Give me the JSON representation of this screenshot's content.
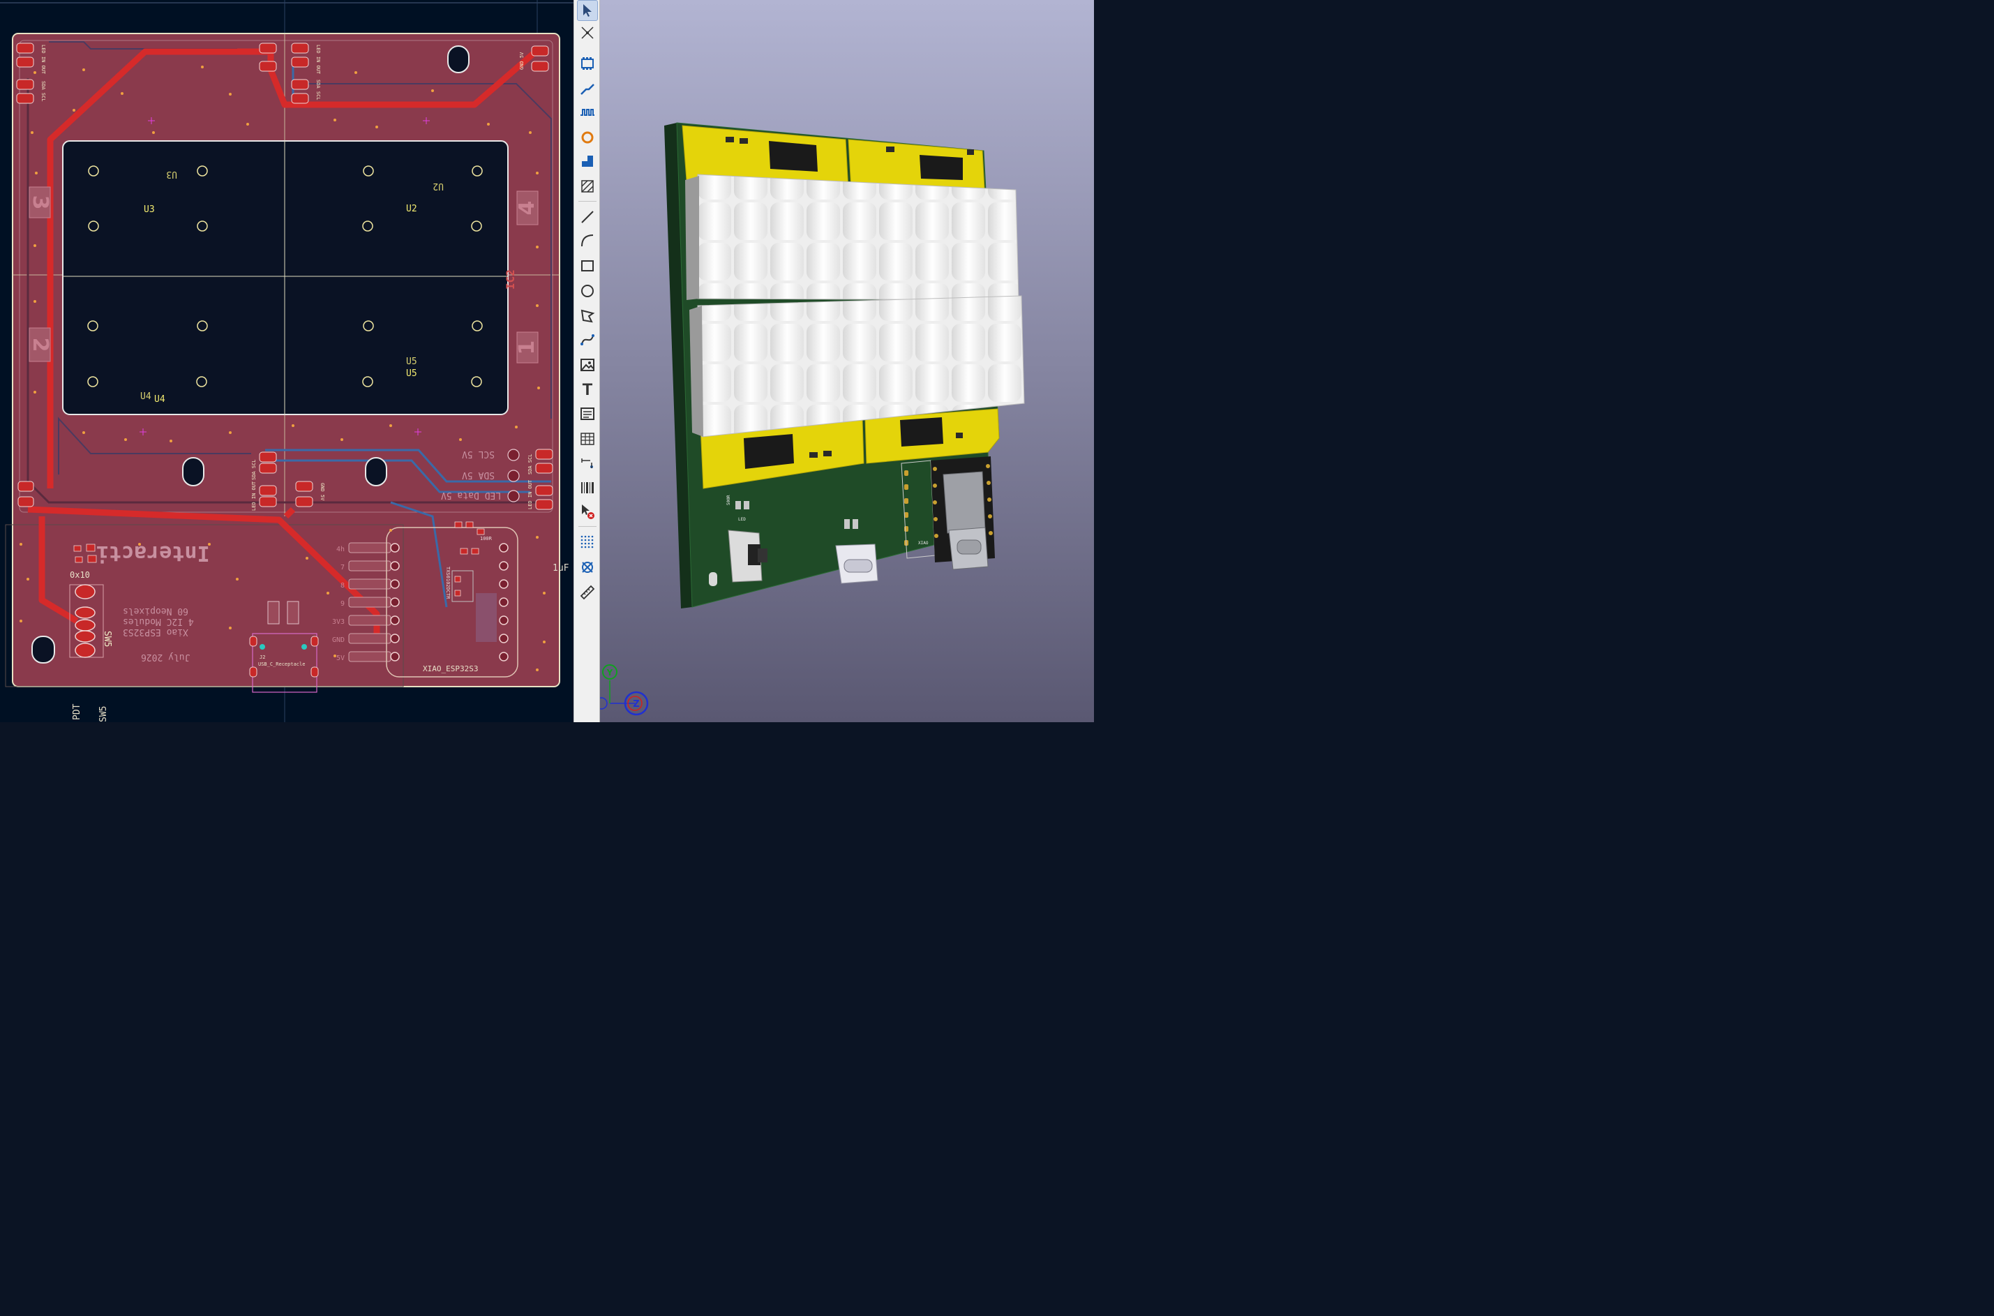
{
  "pcb_editor": {
    "module_refs": [
      "U3",
      "U2",
      "U4",
      "U5"
    ],
    "module_numbers": [
      "3",
      "4",
      "2",
      "1"
    ],
    "side_text": "IC2",
    "connector_labels": {
      "led_in_out": "LED IN OUT",
      "sda_scl": "SDA SCL",
      "gnd_5v": "GND 5V"
    },
    "io_labels": [
      "SCL 5V",
      "SDA 5V",
      "LED Data 5V"
    ],
    "header_pins": [
      "4h",
      "7",
      "8",
      "9",
      "3V3",
      "GND",
      "5V"
    ],
    "logo_text": "Interacti",
    "board_description": [
      "60 Neopixels",
      "4 I2C Modules",
      "Xiao ESP32S3"
    ],
    "date_text": "July 2026",
    "switch_ref": "SW5",
    "switch_value": "0x10",
    "connector_ref": "J2",
    "connector_value": "USB_C_Receptacle",
    "mcu_label": "XIAO_ESP32S3",
    "cap_value": "1uF",
    "bottom_labels": [
      "PDT",
      "SW5"
    ],
    "small_labels": {
      "led_res": "500R",
      "res_100": "100R",
      "level_shifter": "TXS0102DCTR"
    }
  },
  "toolbar": {
    "tools": [
      {
        "name": "select-tool",
        "icon": "arrow-cursor-icon",
        "active": true
      },
      {
        "name": "local-ratsnest-tool",
        "icon": "ratsnest-icon"
      },
      {
        "name": "place-footprint-tool",
        "icon": "footprint-icon"
      },
      {
        "name": "route-track-tool",
        "icon": "route-track-icon"
      },
      {
        "name": "tune-length-tool",
        "icon": "tune-length-icon"
      },
      {
        "name": "add-via-tool",
        "icon": "via-icon"
      },
      {
        "name": "add-zone-tool",
        "icon": "zone-icon"
      },
      {
        "name": "add-rule-area-tool",
        "icon": "rule-area-icon"
      },
      {
        "name": "draw-line-tool",
        "icon": "line-icon"
      },
      {
        "name": "draw-arc-tool",
        "icon": "arc-icon"
      },
      {
        "name": "draw-rectangle-tool",
        "icon": "rectangle-icon"
      },
      {
        "name": "draw-circle-tool",
        "icon": "circle-icon"
      },
      {
        "name": "draw-polygon-tool",
        "icon": "polygon-icon"
      },
      {
        "name": "draw-bezier-tool",
        "icon": "bezier-icon"
      },
      {
        "name": "add-image-tool",
        "icon": "image-icon"
      },
      {
        "name": "add-text-tool",
        "icon": "text-icon"
      },
      {
        "name": "add-textbox-tool",
        "icon": "textbox-icon"
      },
      {
        "name": "add-table-tool",
        "icon": "table-icon"
      },
      {
        "name": "add-dimension-tool",
        "icon": "dimension-icon"
      },
      {
        "name": "add-barcode-tool",
        "icon": "barcode-icon"
      },
      {
        "name": "delete-tool",
        "icon": "delete-cursor-icon"
      },
      {
        "name": "set-grid-origin-tool",
        "icon": "grid-origin-icon"
      },
      {
        "name": "set-drill-origin-tool",
        "icon": "drill-origin-icon"
      },
      {
        "name": "measure-tool",
        "icon": "ruler-icon"
      }
    ],
    "text_tool_glyph": "T"
  },
  "viewer_3d": {
    "axis_labels": {
      "y": "Y",
      "z": "Z"
    },
    "silk_labels": {
      "led": "LED",
      "res": "500R",
      "xiao": "XIAO"
    },
    "colors": {
      "solder_mask": "#1d4a25",
      "module_mask": "#e4d40a",
      "led_diffuser": "#f4f4f4",
      "background_top": "#aeb2ce",
      "background_bottom": "#5b5a74"
    }
  }
}
